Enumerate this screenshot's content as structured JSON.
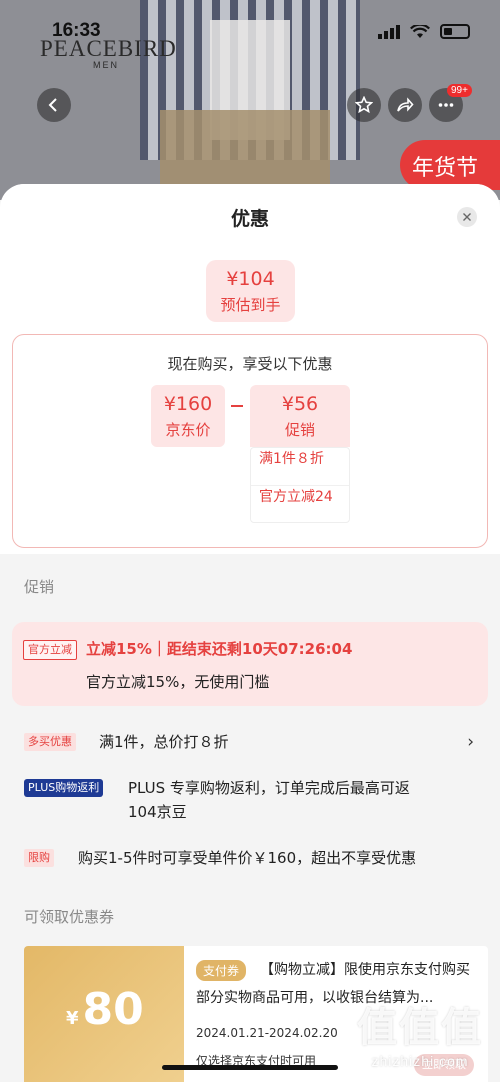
{
  "status_bar": {
    "time": "16:33"
  },
  "hero": {
    "brand": "PEACEBIRD",
    "brand_sub": "MEN",
    "notification_count": "99+",
    "banner_text": "年货节"
  },
  "sheet": {
    "title": "优惠",
    "estimate": {
      "value": "¥104",
      "label": "预估到手"
    },
    "calc": {
      "header": "现在购买，享受以下优惠",
      "jd_price": {
        "value": "¥160",
        "label": "京东价"
      },
      "promo": {
        "value": "¥56",
        "label": "促销"
      },
      "promo_items": [
        "满1件８折",
        "官方立减24"
      ]
    },
    "promo_section_label": "促销",
    "official": {
      "tag": "官方立减",
      "line1": "立减15%｜距结束还剩10天07:26:04",
      "line2": "官方立减15%，无使用门槛"
    },
    "rows": [
      {
        "tag": "多买优惠",
        "text": "满1件，总价打８折"
      },
      {
        "tag": "PLUS购物返利",
        "text": "PLUS 专享购物返利，订单完成后最高可返",
        "text2": "104京豆"
      },
      {
        "tag": "限购",
        "text": "购买1-5件时可享受单件价￥160，超出不享受优惠"
      }
    ],
    "coupon_section_label": "可领取优惠券",
    "coupon": {
      "currency": "¥",
      "amount": "80",
      "tag": "支付券",
      "description": "【购物立减】限使用京东支付购买部分实物商品可用，以收银台结算为...",
      "date_range": "2024.01.21-2024.02.20",
      "note": "仅选择京东支付时可用",
      "claim_label": "立即领取"
    }
  },
  "watermark": {
    "big": "值值值",
    "small": "zhizhizhi.com"
  },
  "colors": {
    "accent": "#e5413f",
    "pink_bg": "#fde5e5",
    "plus_blue": "#1e3a94",
    "coupon_gold": "#e3b867"
  }
}
